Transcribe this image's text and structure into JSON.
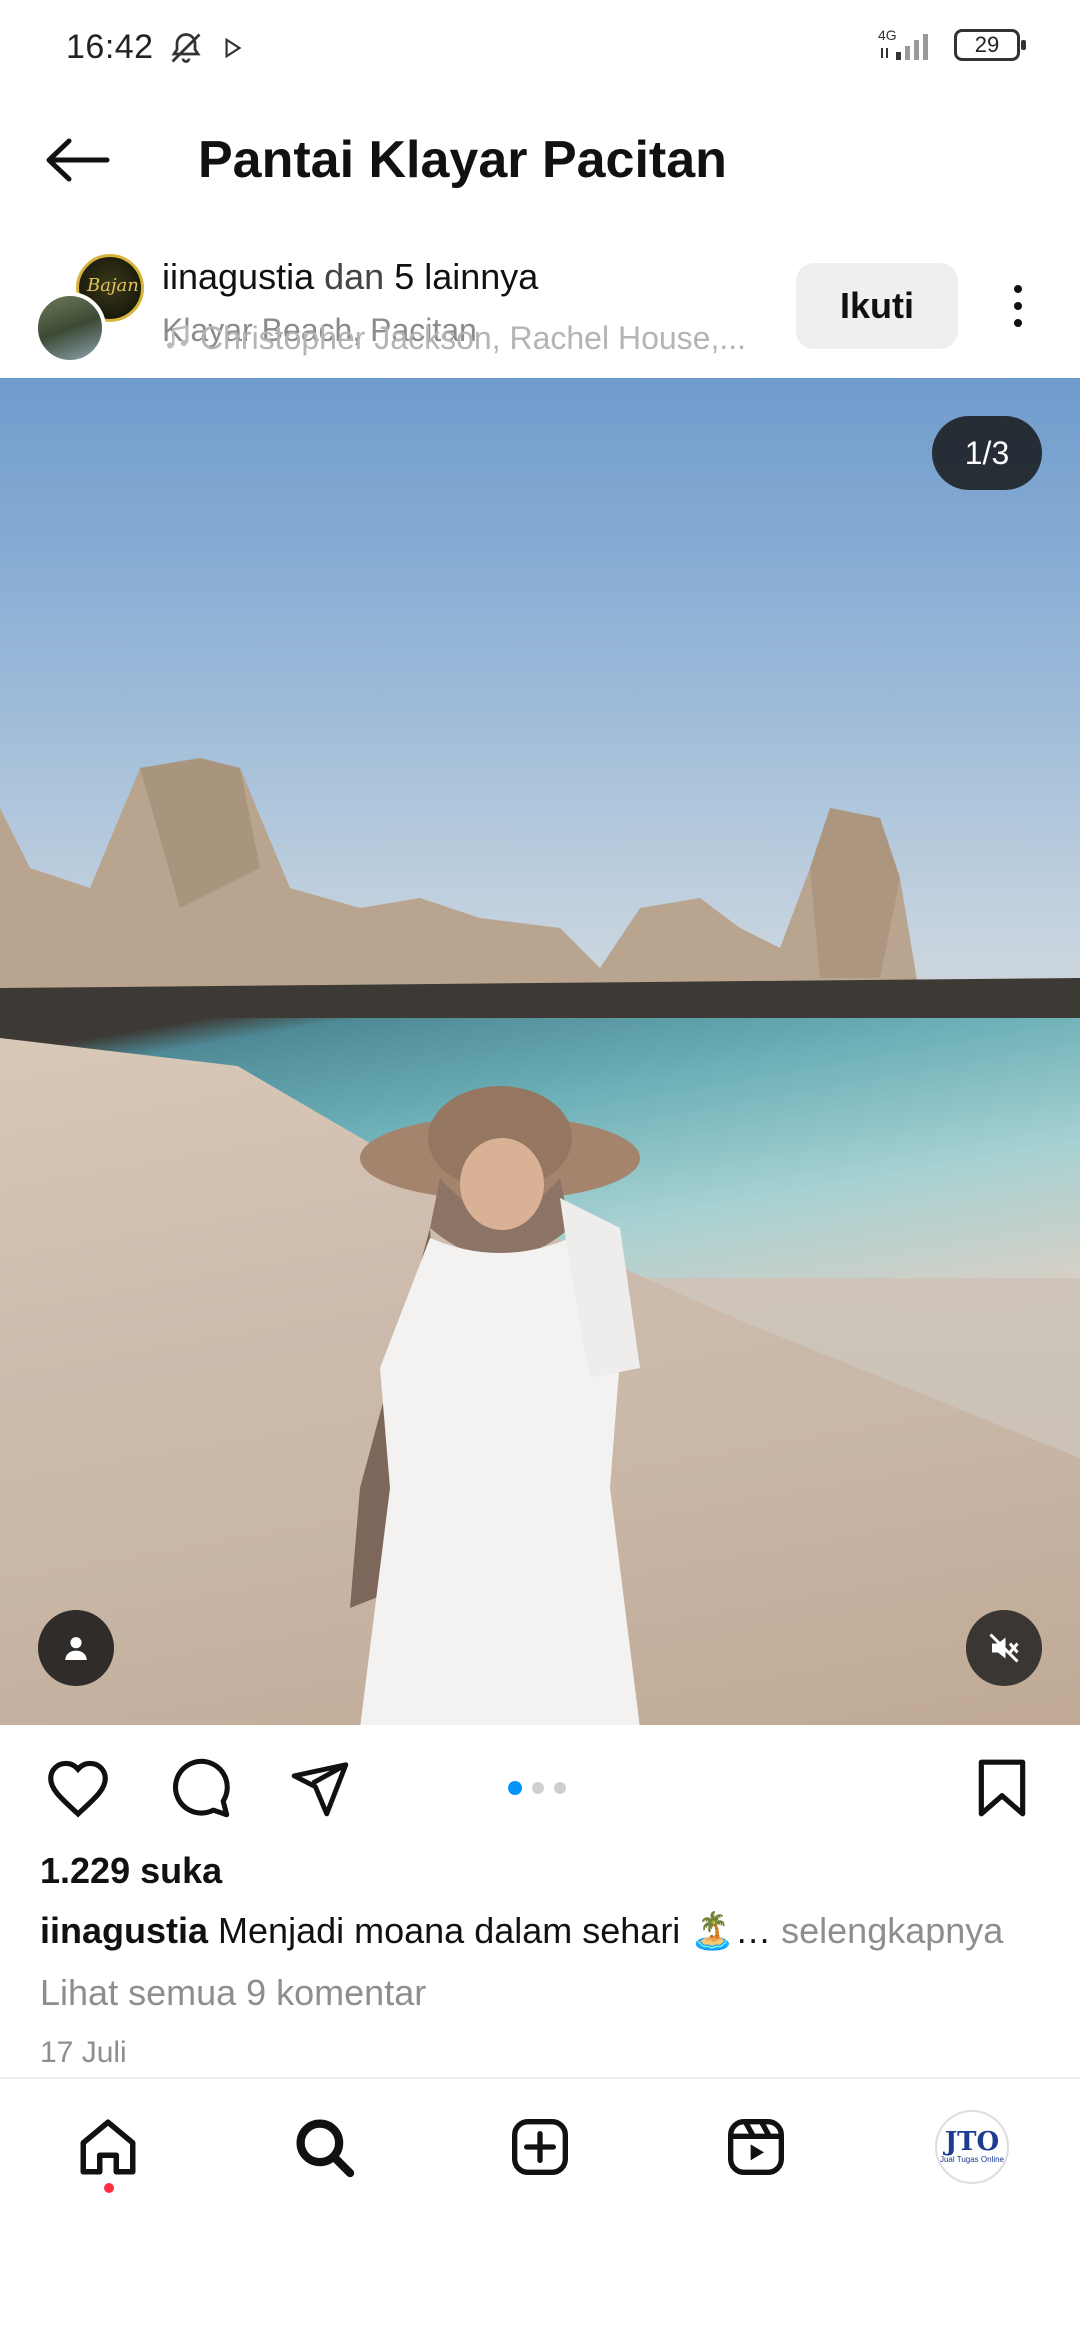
{
  "status_bar": {
    "time": "16:42",
    "network": "4G",
    "battery": "29"
  },
  "header": {
    "title": "Pantai Klayar Pacitan",
    "back_icon": "arrow-left-icon"
  },
  "post": {
    "user": "iinagustia",
    "coauthors_joiner": "dan",
    "coauthors_count": "5 lainnya",
    "location": "Klayar Beach, Pacitan",
    "music": "Christopher Jackson, Rachel House,...",
    "follow_label": "Ikuti",
    "avatar_a_text": "Bajan",
    "counter": "1/3",
    "carousel_total": 3,
    "carousel_index": 1
  },
  "engagement": {
    "likes": "1.229 suka",
    "caption_user": "iinagustia",
    "caption_text": "Menjadi moana dalam sehari 🏝️…",
    "caption_more": "selengkapnya",
    "comments_link": "Lihat semua 9 komentar",
    "date": "17 Juli"
  },
  "bottom_nav": {
    "items": [
      "home-icon",
      "search-icon",
      "add-icon",
      "reels-icon",
      "profile-avatar"
    ],
    "profile_logo": "JTO",
    "profile_tagline": "Jual Tugas Online"
  },
  "colors": {
    "accent": "#0095f6",
    "notification": "#ff3040",
    "secondary_text": "#8e8e8e",
    "button_bg": "#efeff1"
  }
}
